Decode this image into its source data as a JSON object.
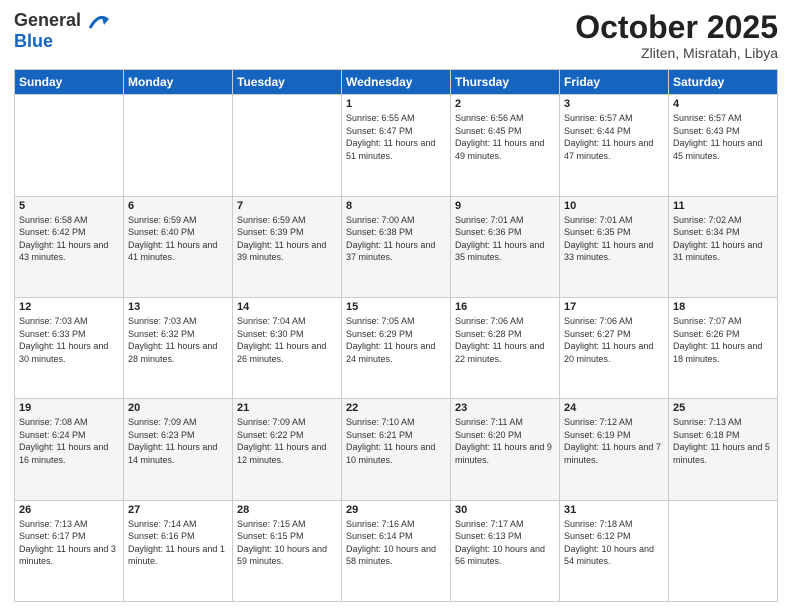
{
  "header": {
    "logo_line1": "General",
    "logo_line2": "Blue",
    "month": "October 2025",
    "location": "Zliten, Misratah, Libya"
  },
  "weekdays": [
    "Sunday",
    "Monday",
    "Tuesday",
    "Wednesday",
    "Thursday",
    "Friday",
    "Saturday"
  ],
  "weeks": [
    [
      {
        "day": "",
        "sunrise": "",
        "sunset": "",
        "daylight": ""
      },
      {
        "day": "",
        "sunrise": "",
        "sunset": "",
        "daylight": ""
      },
      {
        "day": "",
        "sunrise": "",
        "sunset": "",
        "daylight": ""
      },
      {
        "day": "1",
        "sunrise": "Sunrise: 6:55 AM",
        "sunset": "Sunset: 6:47 PM",
        "daylight": "Daylight: 11 hours and 51 minutes."
      },
      {
        "day": "2",
        "sunrise": "Sunrise: 6:56 AM",
        "sunset": "Sunset: 6:45 PM",
        "daylight": "Daylight: 11 hours and 49 minutes."
      },
      {
        "day": "3",
        "sunrise": "Sunrise: 6:57 AM",
        "sunset": "Sunset: 6:44 PM",
        "daylight": "Daylight: 11 hours and 47 minutes."
      },
      {
        "day": "4",
        "sunrise": "Sunrise: 6:57 AM",
        "sunset": "Sunset: 6:43 PM",
        "daylight": "Daylight: 11 hours and 45 minutes."
      }
    ],
    [
      {
        "day": "5",
        "sunrise": "Sunrise: 6:58 AM",
        "sunset": "Sunset: 6:42 PM",
        "daylight": "Daylight: 11 hours and 43 minutes."
      },
      {
        "day": "6",
        "sunrise": "Sunrise: 6:59 AM",
        "sunset": "Sunset: 6:40 PM",
        "daylight": "Daylight: 11 hours and 41 minutes."
      },
      {
        "day": "7",
        "sunrise": "Sunrise: 6:59 AM",
        "sunset": "Sunset: 6:39 PM",
        "daylight": "Daylight: 11 hours and 39 minutes."
      },
      {
        "day": "8",
        "sunrise": "Sunrise: 7:00 AM",
        "sunset": "Sunset: 6:38 PM",
        "daylight": "Daylight: 11 hours and 37 minutes."
      },
      {
        "day": "9",
        "sunrise": "Sunrise: 7:01 AM",
        "sunset": "Sunset: 6:36 PM",
        "daylight": "Daylight: 11 hours and 35 minutes."
      },
      {
        "day": "10",
        "sunrise": "Sunrise: 7:01 AM",
        "sunset": "Sunset: 6:35 PM",
        "daylight": "Daylight: 11 hours and 33 minutes."
      },
      {
        "day": "11",
        "sunrise": "Sunrise: 7:02 AM",
        "sunset": "Sunset: 6:34 PM",
        "daylight": "Daylight: 11 hours and 31 minutes."
      }
    ],
    [
      {
        "day": "12",
        "sunrise": "Sunrise: 7:03 AM",
        "sunset": "Sunset: 6:33 PM",
        "daylight": "Daylight: 11 hours and 30 minutes."
      },
      {
        "day": "13",
        "sunrise": "Sunrise: 7:03 AM",
        "sunset": "Sunset: 6:32 PM",
        "daylight": "Daylight: 11 hours and 28 minutes."
      },
      {
        "day": "14",
        "sunrise": "Sunrise: 7:04 AM",
        "sunset": "Sunset: 6:30 PM",
        "daylight": "Daylight: 11 hours and 26 minutes."
      },
      {
        "day": "15",
        "sunrise": "Sunrise: 7:05 AM",
        "sunset": "Sunset: 6:29 PM",
        "daylight": "Daylight: 11 hours and 24 minutes."
      },
      {
        "day": "16",
        "sunrise": "Sunrise: 7:06 AM",
        "sunset": "Sunset: 6:28 PM",
        "daylight": "Daylight: 11 hours and 22 minutes."
      },
      {
        "day": "17",
        "sunrise": "Sunrise: 7:06 AM",
        "sunset": "Sunset: 6:27 PM",
        "daylight": "Daylight: 11 hours and 20 minutes."
      },
      {
        "day": "18",
        "sunrise": "Sunrise: 7:07 AM",
        "sunset": "Sunset: 6:26 PM",
        "daylight": "Daylight: 11 hours and 18 minutes."
      }
    ],
    [
      {
        "day": "19",
        "sunrise": "Sunrise: 7:08 AM",
        "sunset": "Sunset: 6:24 PM",
        "daylight": "Daylight: 11 hours and 16 minutes."
      },
      {
        "day": "20",
        "sunrise": "Sunrise: 7:09 AM",
        "sunset": "Sunset: 6:23 PM",
        "daylight": "Daylight: 11 hours and 14 minutes."
      },
      {
        "day": "21",
        "sunrise": "Sunrise: 7:09 AM",
        "sunset": "Sunset: 6:22 PM",
        "daylight": "Daylight: 11 hours and 12 minutes."
      },
      {
        "day": "22",
        "sunrise": "Sunrise: 7:10 AM",
        "sunset": "Sunset: 6:21 PM",
        "daylight": "Daylight: 11 hours and 10 minutes."
      },
      {
        "day": "23",
        "sunrise": "Sunrise: 7:11 AM",
        "sunset": "Sunset: 6:20 PM",
        "daylight": "Daylight: 11 hours and 9 minutes."
      },
      {
        "day": "24",
        "sunrise": "Sunrise: 7:12 AM",
        "sunset": "Sunset: 6:19 PM",
        "daylight": "Daylight: 11 hours and 7 minutes."
      },
      {
        "day": "25",
        "sunrise": "Sunrise: 7:13 AM",
        "sunset": "Sunset: 6:18 PM",
        "daylight": "Daylight: 11 hours and 5 minutes."
      }
    ],
    [
      {
        "day": "26",
        "sunrise": "Sunrise: 7:13 AM",
        "sunset": "Sunset: 6:17 PM",
        "daylight": "Daylight: 11 hours and 3 minutes."
      },
      {
        "day": "27",
        "sunrise": "Sunrise: 7:14 AM",
        "sunset": "Sunset: 6:16 PM",
        "daylight": "Daylight: 11 hours and 1 minute."
      },
      {
        "day": "28",
        "sunrise": "Sunrise: 7:15 AM",
        "sunset": "Sunset: 6:15 PM",
        "daylight": "Daylight: 10 hours and 59 minutes."
      },
      {
        "day": "29",
        "sunrise": "Sunrise: 7:16 AM",
        "sunset": "Sunset: 6:14 PM",
        "daylight": "Daylight: 10 hours and 58 minutes."
      },
      {
        "day": "30",
        "sunrise": "Sunrise: 7:17 AM",
        "sunset": "Sunset: 6:13 PM",
        "daylight": "Daylight: 10 hours and 56 minutes."
      },
      {
        "day": "31",
        "sunrise": "Sunrise: 7:18 AM",
        "sunset": "Sunset: 6:12 PM",
        "daylight": "Daylight: 10 hours and 54 minutes."
      },
      {
        "day": "",
        "sunrise": "",
        "sunset": "",
        "daylight": ""
      }
    ]
  ]
}
